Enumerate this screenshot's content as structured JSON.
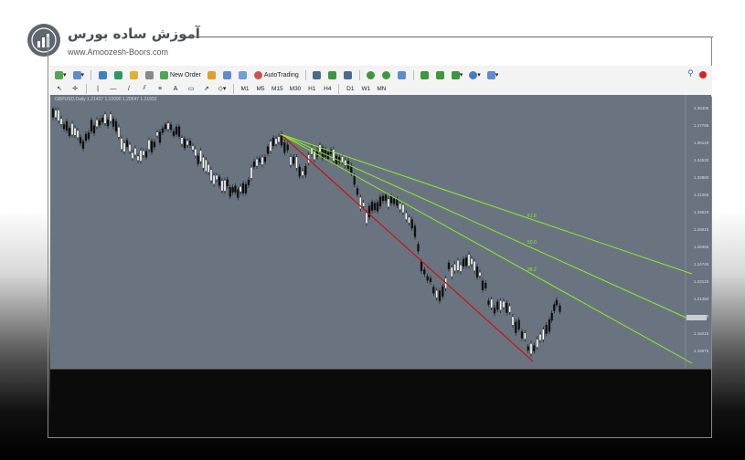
{
  "brand": {
    "name_fa": "آموزش ساده بورس",
    "url": "www.Amoozesh-Boors.com",
    "logo_icon": "chart-bars-icon"
  },
  "toolbar": {
    "new_order": "New Order",
    "auto_trading": "AutoTrading",
    "timeframes": [
      "M1",
      "M5",
      "M15",
      "M30",
      "H1",
      "H4",
      "D1",
      "W1",
      "MN"
    ],
    "tools": [
      "A"
    ]
  },
  "chart": {
    "symbol_line": "GBPUSD,Daily  1.21437 1.22090 1.20647 1.21932",
    "fan_labels": [
      "61.8",
      "50.0",
      "38.2"
    ],
    "price_scale": [
      "1.39405",
      "1.37785",
      "1.36140",
      "1.34520",
      "1.32880",
      "1.31265",
      "1.29620",
      "1.28010",
      "1.26365",
      "1.24745",
      "1.23125",
      "1.21480",
      "1.19830",
      "1.18210",
      "1.16575"
    ],
    "colors": {
      "background": "#6a7480",
      "bull": "#ffffff",
      "bear": "#111111",
      "trend": "#cc1111",
      "fan": "#88ee22"
    }
  }
}
